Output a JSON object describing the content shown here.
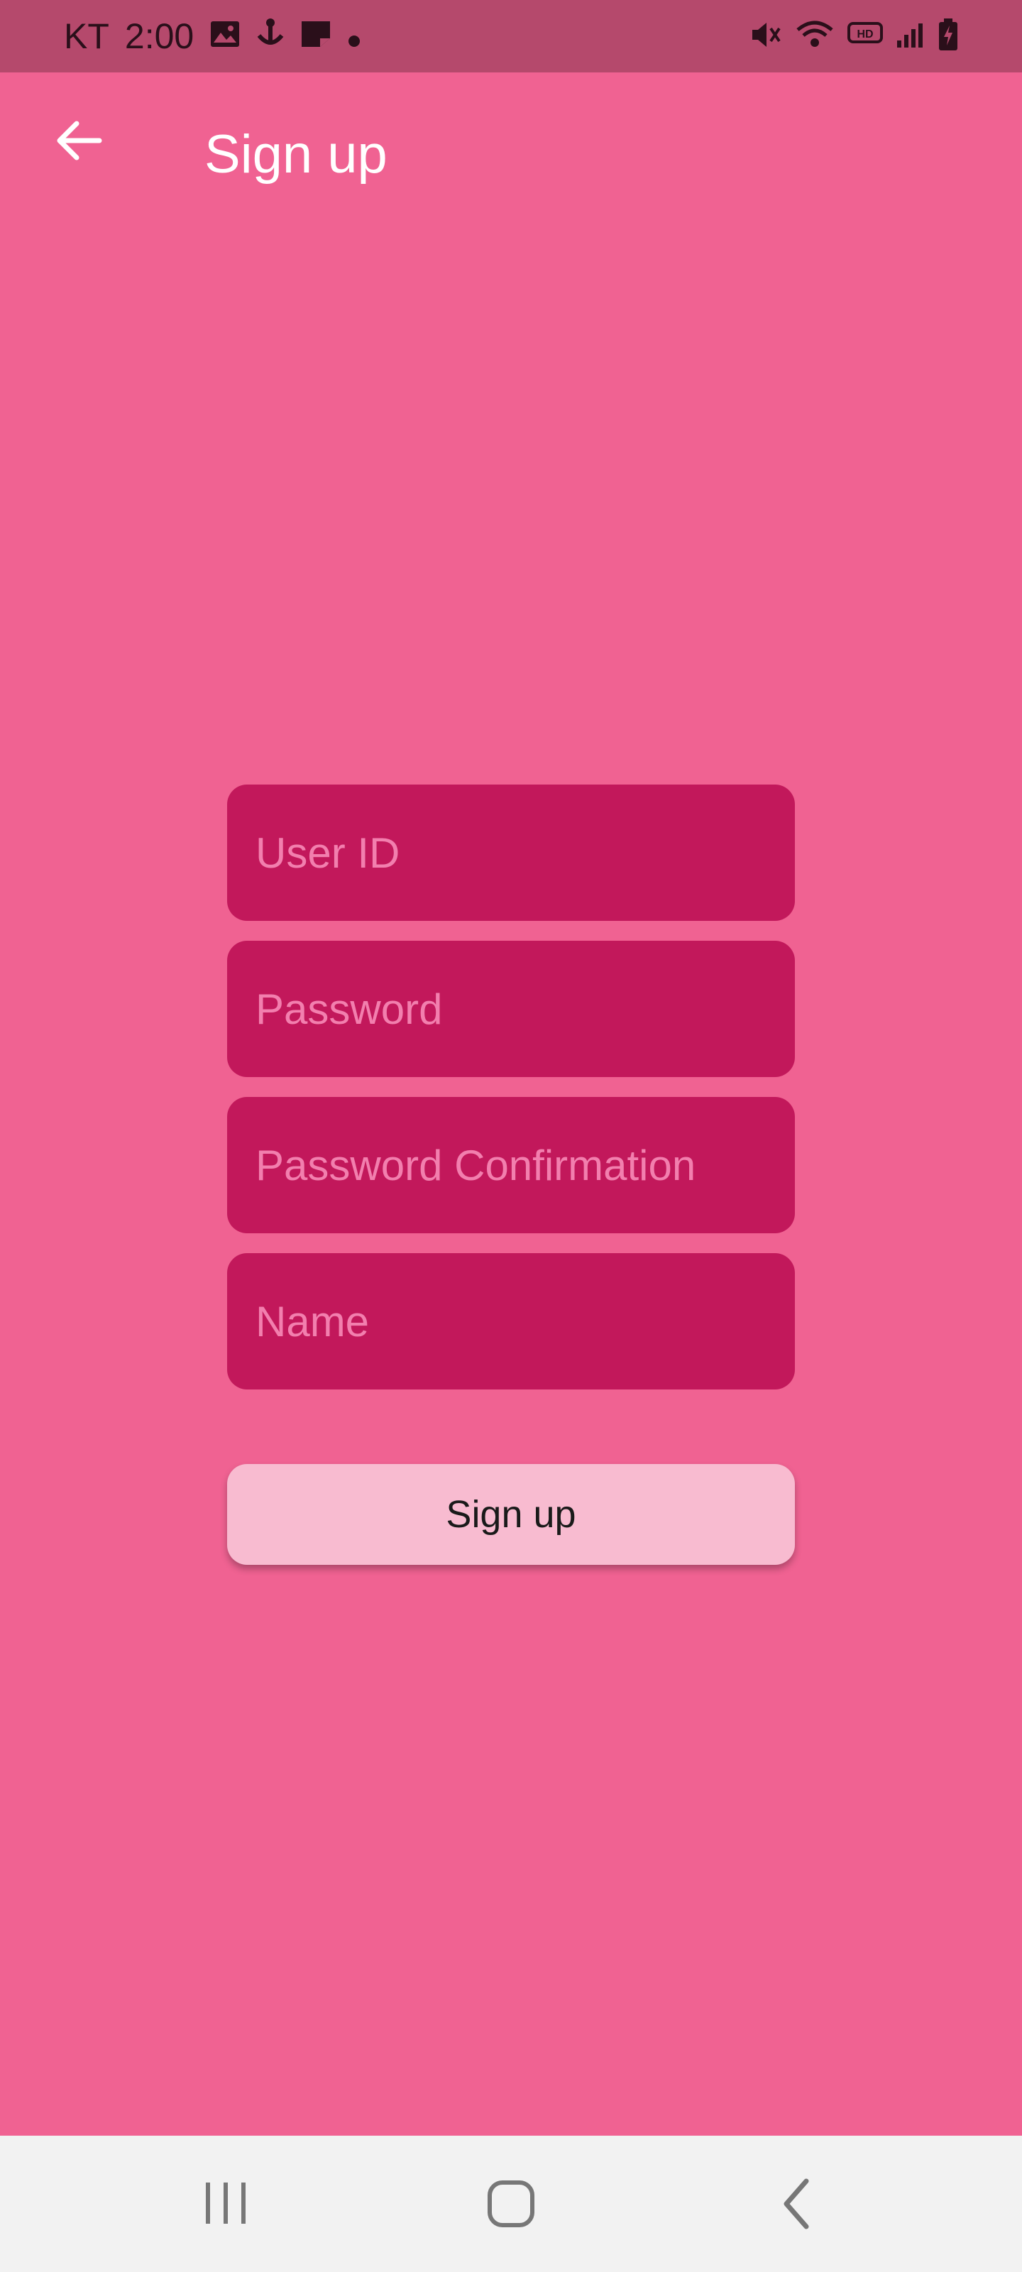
{
  "status_bar": {
    "carrier": "KT",
    "time": "2:00",
    "left_icons": [
      "image-icon",
      "anchor-icon",
      "sticky-note-icon",
      "dot-icon"
    ],
    "right_icons": [
      "mute-icon",
      "wifi-icon",
      "hd-voice-icon",
      "signal-icon",
      "battery-charging-icon"
    ]
  },
  "app_bar": {
    "title": "Sign up",
    "back_icon": "arrow-left-icon"
  },
  "form": {
    "user_id_placeholder": "User ID",
    "password_placeholder": "Password",
    "password_confirm_placeholder": "Password Confirmation",
    "name_placeholder": "Name",
    "submit_label": "Sign up"
  },
  "nav_bar": {
    "items": [
      "recent-apps-icon",
      "home-icon",
      "back-icon"
    ]
  },
  "colors": {
    "background": "#f06292",
    "status_bar": "#b5496c",
    "field_bg": "#c2185b",
    "placeholder": "#f27fae",
    "button_bg": "#f8bbd0",
    "nav_bar": "#f2f2f2"
  }
}
